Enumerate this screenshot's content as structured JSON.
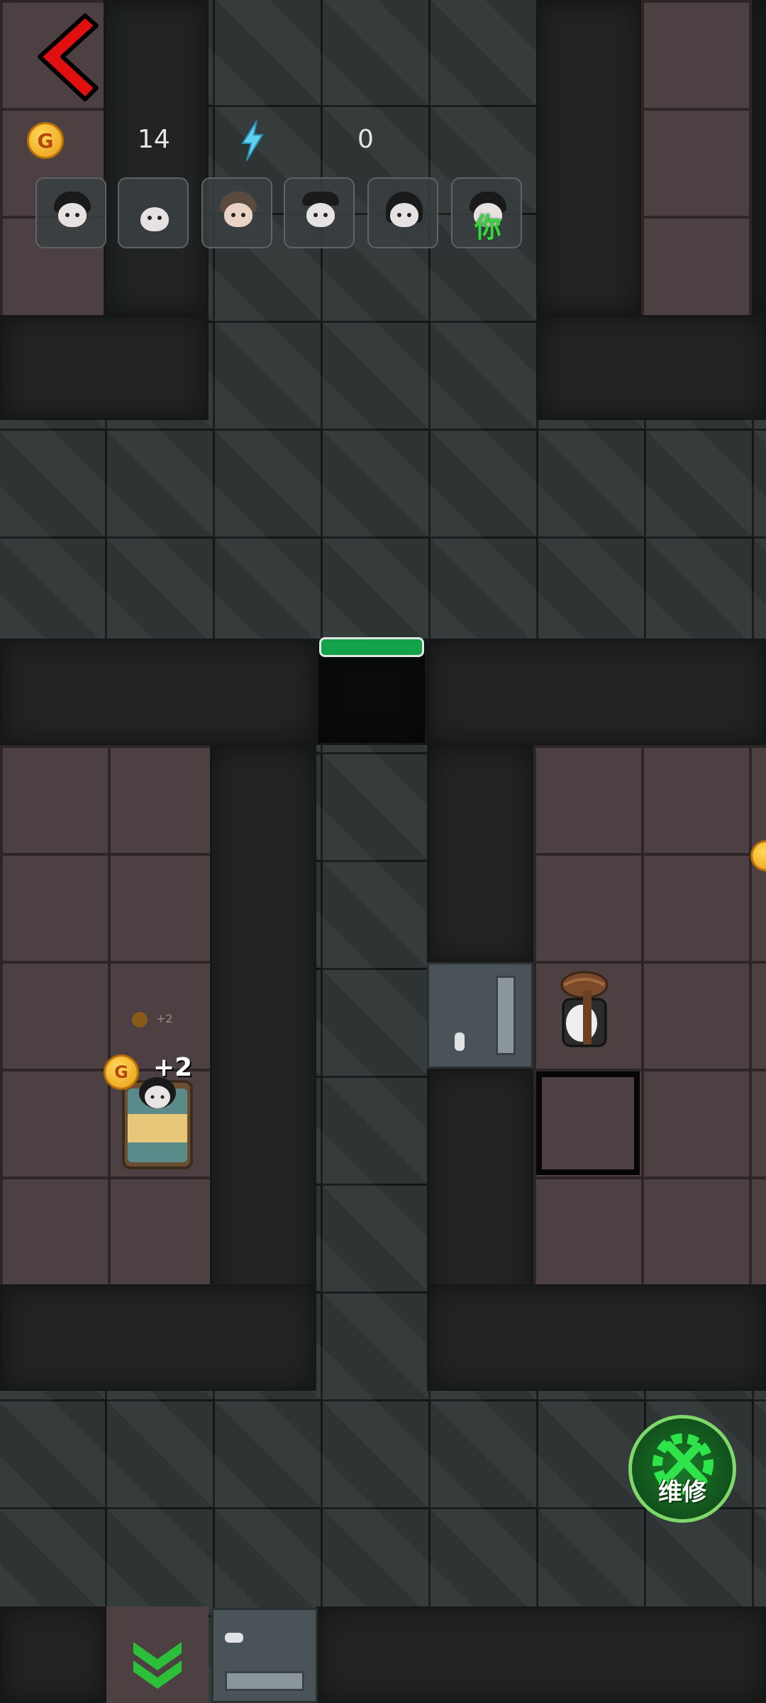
{
  "hud": {
    "coins": "14",
    "energy": "0",
    "coin_symbol": "G",
    "you_label": "你"
  },
  "players": [
    {
      "name": "avatar-1",
      "is_you": false
    },
    {
      "name": "avatar-2",
      "is_you": false
    },
    {
      "name": "avatar-3",
      "is_you": false
    },
    {
      "name": "avatar-4",
      "is_you": false
    },
    {
      "name": "avatar-5",
      "is_you": false
    },
    {
      "name": "avatar-6",
      "is_you": true
    }
  ],
  "map": {
    "door_hp_fraction": 1.0,
    "bed_income_label": "+2",
    "small_income_label": "+2",
    "coin_symbol": "G"
  },
  "actions": {
    "repair_label": "维修"
  },
  "colors": {
    "hp_bar": "#13a24a",
    "repair_button": "#1b7a2a",
    "back_arrow": "#e01010",
    "coin": "#f5b82a"
  }
}
